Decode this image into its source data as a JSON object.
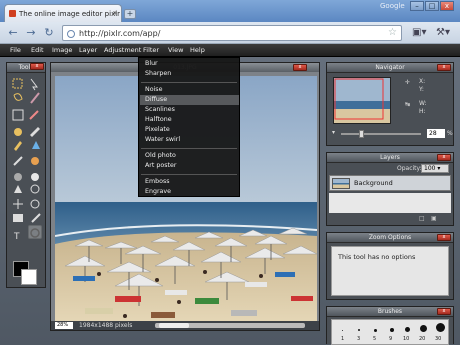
{
  "browser": {
    "tab_title": "The online image editor pixlr",
    "tab_close": "x",
    "new_tab": "+",
    "brand": "Google",
    "url": "http://pixlr.com/app/",
    "window_buttons": [
      "–",
      "□",
      "x"
    ]
  },
  "menu": {
    "items": [
      "File",
      "Edit",
      "Image",
      "Layer",
      "Adjustment",
      "Filter",
      "View",
      "Help"
    ]
  },
  "filter_menu": {
    "groups": [
      [
        "Blur",
        "Sharpen"
      ],
      [
        "Noise",
        "Diffuse",
        "Scanlines",
        "Halftone",
        "Pixelate",
        "Water swirl"
      ],
      [
        "Old photo",
        "Art poster"
      ],
      [
        "Emboss",
        "Engrave"
      ]
    ],
    "highlighted": "Diffuse"
  },
  "tools_panel": {
    "title": "Tools",
    "close": "x"
  },
  "canvas": {
    "title": "013.JPG",
    "zoom": "28%",
    "pixels": "1984x1488 pixels"
  },
  "navigator": {
    "title": "Navigator",
    "x_label": "X:",
    "y_label": "Y:",
    "w_label": "W:",
    "h_label": "H:",
    "zoom": "28",
    "percent": "%"
  },
  "layers": {
    "title": "Layers",
    "opacity_label": "Opacity:",
    "opacity_value": "100",
    "layer_name": "Background"
  },
  "zoom_options": {
    "title": "Zoom Options",
    "message": "This tool has no options"
  },
  "brushes": {
    "title": "Brushes",
    "sizes": [
      "1",
      "3",
      "5",
      "9",
      "10",
      "20",
      "30"
    ]
  },
  "colors": {
    "accent_close": "#c8402f",
    "sea": "#3f6f9a",
    "sand": "#d9c7a0",
    "sky": "#9fb7cf"
  }
}
